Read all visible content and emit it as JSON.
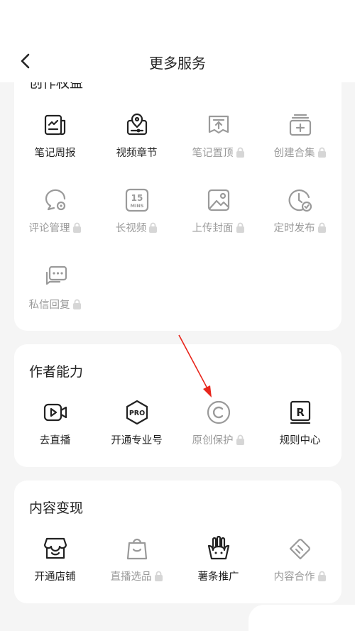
{
  "header": {
    "title": "更多服务"
  },
  "creation": {
    "title": "创作权益",
    "items": [
      {
        "label": "笔记周报",
        "icon": "report-chart-icon",
        "locked": false
      },
      {
        "label": "视频章节",
        "icon": "video-chapter-icon",
        "locked": false
      },
      {
        "label": "笔记置顶",
        "icon": "pin-top-icon",
        "locked": true
      },
      {
        "label": "创建合集",
        "icon": "create-collection-icon",
        "locked": true
      },
      {
        "label": "评论管理",
        "icon": "comment-manage-icon",
        "locked": true
      },
      {
        "label": "长视频",
        "icon": "15-mins-icon",
        "locked": true
      },
      {
        "label": "上传封面",
        "icon": "upload-cover-icon",
        "locked": true
      },
      {
        "label": "定时发布",
        "icon": "scheduled-publish-icon",
        "locked": true
      },
      {
        "label": "私信回复",
        "icon": "message-reply-icon",
        "locked": true
      }
    ],
    "badge_text": {
      "mins_top": "15",
      "mins_bottom": "MINS"
    }
  },
  "author": {
    "title": "作者能力",
    "items": [
      {
        "label": "去直播",
        "icon": "live-camera-icon",
        "locked": false
      },
      {
        "label": "开通专业号",
        "icon": "pro-badge-icon",
        "locked": false
      },
      {
        "label": "原创保护",
        "icon": "copyright-icon",
        "locked": true
      },
      {
        "label": "规则中心",
        "icon": "rules-book-icon",
        "locked": false
      }
    ],
    "pro_text": "PRO",
    "rules_letter": "R"
  },
  "monetize": {
    "title": "内容变现",
    "items": [
      {
        "label": "开通店铺",
        "icon": "shop-icon",
        "locked": false
      },
      {
        "label": "直播选品",
        "icon": "shopping-bag-icon",
        "locked": true
      },
      {
        "label": "薯条推广",
        "icon": "fries-promo-icon",
        "locked": false
      },
      {
        "label": "内容合作",
        "icon": "content-cooperation-icon",
        "locked": true
      }
    ]
  },
  "colors": {
    "icon_active": "#222222",
    "icon_locked": "#9a9a9a",
    "arrow": "#e8261c"
  }
}
